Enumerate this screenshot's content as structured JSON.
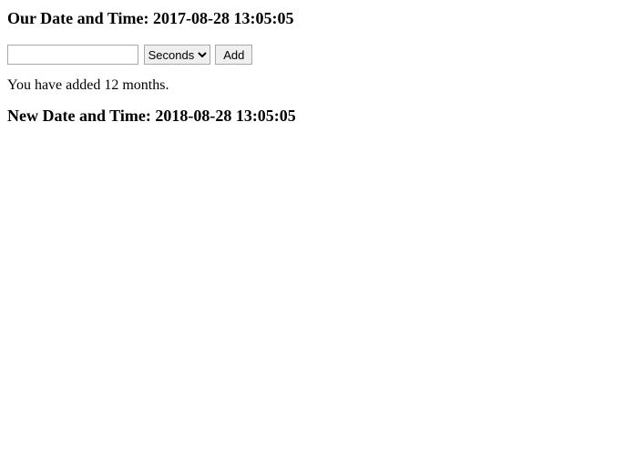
{
  "heading1": "Our Date and Time: 2017-08-28 13:05:05",
  "form": {
    "input_value": "",
    "selected_unit": "Seconds",
    "add_label": "Add"
  },
  "status_text": "You have added 12 months.",
  "heading2": "New Date and Time: 2018-08-28 13:05:05"
}
